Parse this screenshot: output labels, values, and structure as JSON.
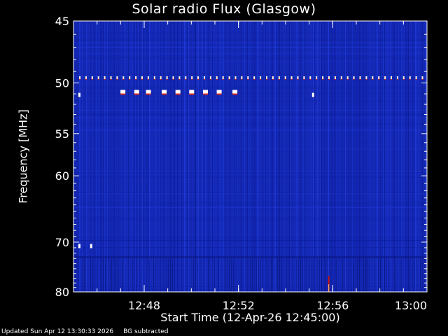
{
  "chart_data": {
    "type": "heatmap",
    "title": "Solar radio Flux (Glasgow)",
    "ylabel": "Frequency [MHz]",
    "xlabel": "Start Time (12-Apr-26 12:45:00)",
    "x_range": [
      "12:45",
      "13:00"
    ],
    "x_ticks": [
      "12:48",
      "12:52",
      "12:56",
      "13:00"
    ],
    "y_range": [
      45,
      80
    ],
    "y_ticks": [
      45,
      50,
      55,
      60,
      70,
      80
    ],
    "y_scale": "reciprocal",
    "colormap": [
      "#000070",
      "#0a1aa0",
      "#1a34d0",
      "#3050ff",
      "#c81414",
      "#ffe0a0",
      "#ffffff"
    ],
    "background_level": "blue",
    "features": [
      {
        "type": "dashed_line",
        "freq_mhz": 49.6,
        "time_start": "12:45",
        "time_end": "13:00",
        "description": "persistent interference dashes"
      },
      {
        "type": "blocks",
        "freq_mhz": 50.9,
        "times": [
          "12:47:05",
          "12:47:40",
          "12:48:10",
          "12:48:50",
          "12:49:25",
          "12:50:00",
          "12:50:35",
          "12:51:10",
          "12:51:50"
        ]
      },
      {
        "type": "spot",
        "freq_mhz": 51.1,
        "time": "12:45:15"
      },
      {
        "type": "spot",
        "freq_mhz": 51.1,
        "time": "12:55:10"
      },
      {
        "type": "spot",
        "freq_mhz": 70.7,
        "time": "12:45:15"
      },
      {
        "type": "spot",
        "freq_mhz": 70.7,
        "time": "12:45:45"
      },
      {
        "type": "vertical_burst",
        "freq_start_mhz": 76.5,
        "freq_end_mhz": 80,
        "time": "12:55:50"
      }
    ]
  },
  "footer": {
    "updated": "Updated Sun Apr 12 13:30:33 2026",
    "bg": "BG subtracted"
  }
}
